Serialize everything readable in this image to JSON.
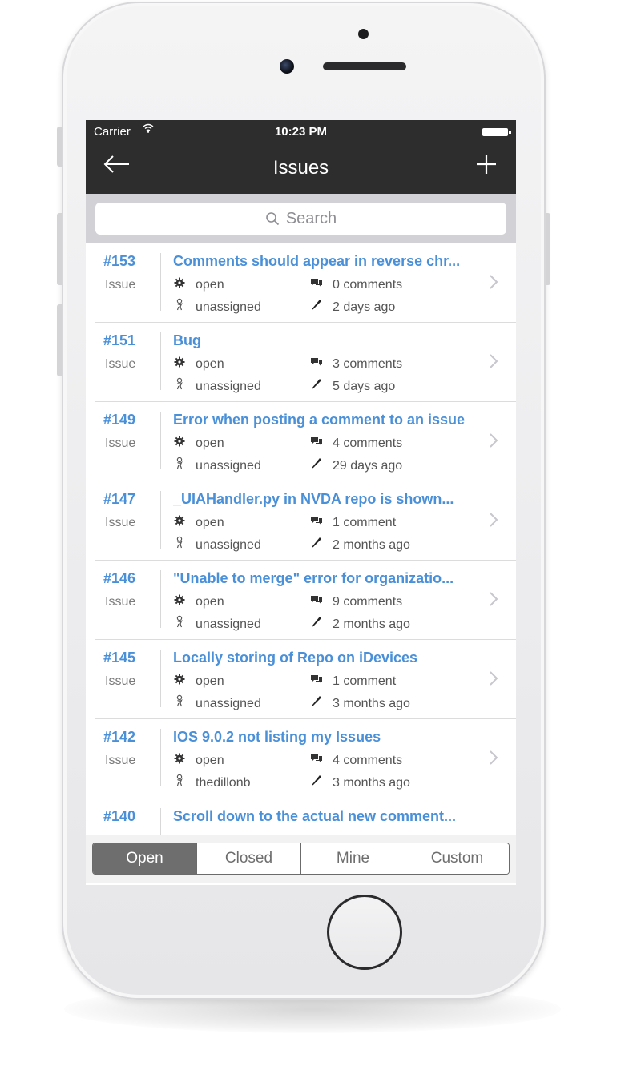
{
  "status_bar": {
    "carrier": "Carrier",
    "wifi_icon": "wifi-icon",
    "time": "10:23 PM",
    "battery_icon": "battery-icon"
  },
  "nav": {
    "title": "Issues",
    "back_icon": "arrow-left-icon",
    "add_icon": "plus-icon"
  },
  "search": {
    "placeholder": "Search"
  },
  "colors": {
    "navbar": "#2d2d2d",
    "link": "#4a90d9",
    "search_bar": "#d1d1d6",
    "segment_active": "#6e6e6e"
  },
  "issues": [
    {
      "number": "#153",
      "type": "Issue",
      "title": "Comments should appear in reverse chr...",
      "state": "open",
      "assignee": "unassigned",
      "comments": "0 comments",
      "updated": "2 days ago"
    },
    {
      "number": "#151",
      "type": "Issue",
      "title": "Bug",
      "state": "open",
      "assignee": "unassigned",
      "comments": "3 comments",
      "updated": "5 days ago"
    },
    {
      "number": "#149",
      "type": "Issue",
      "title": "Error when posting a comment to an issue",
      "state": "open",
      "assignee": "unassigned",
      "comments": "4 comments",
      "updated": "29 days ago"
    },
    {
      "number": "#147",
      "type": "Issue",
      "title": "_UIAHandler.py in NVDA repo is shown...",
      "state": "open",
      "assignee": "unassigned",
      "comments": "1 comment",
      "updated": "2 months ago"
    },
    {
      "number": "#146",
      "type": "Issue",
      "title": "\"Unable to merge\" error for organizatio...",
      "state": "open",
      "assignee": "unassigned",
      "comments": "9 comments",
      "updated": "2 months ago"
    },
    {
      "number": "#145",
      "type": "Issue",
      "title": "Locally storing of Repo on iDevices",
      "state": "open",
      "assignee": "unassigned",
      "comments": "1 comment",
      "updated": "3 months ago"
    },
    {
      "number": "#142",
      "type": "Issue",
      "title": "IOS 9.0.2 not listing my Issues",
      "state": "open",
      "assignee": "thedillonb",
      "comments": "4 comments",
      "updated": "3 months ago"
    },
    {
      "number": "#140",
      "type": "",
      "title": "Scroll down to the actual new comment...",
      "state": "",
      "assignee": "",
      "comments": "",
      "updated": ""
    }
  ],
  "filter_tabs": [
    {
      "label": "Open",
      "active": true
    },
    {
      "label": "Closed",
      "active": false
    },
    {
      "label": "Mine",
      "active": false
    },
    {
      "label": "Custom",
      "active": false
    }
  ]
}
